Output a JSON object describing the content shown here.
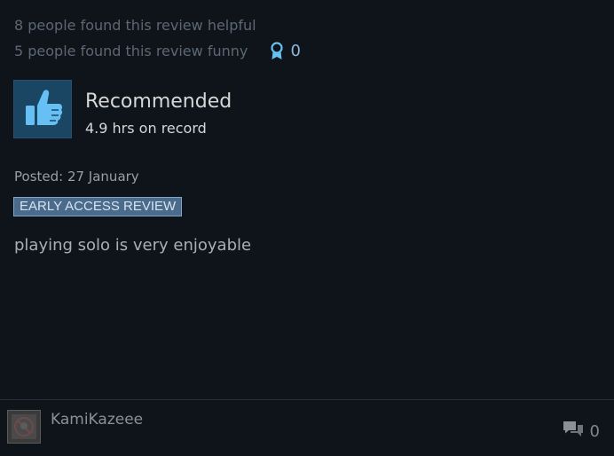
{
  "review": {
    "helpful_text": "8 people found this review helpful",
    "funny_text": "5 people found this review funny",
    "award_count": "0",
    "recommendation": "Recommended",
    "hours": "4.9 hrs on record",
    "posted": "Posted: 27 January",
    "badge": "EARLY ACCESS REVIEW",
    "body": "playing solo is very enjoyable"
  },
  "author": {
    "name": "KamiKazeee",
    "comment_count": "0"
  },
  "icons": {
    "thumb": "thumbs-up-icon",
    "award": "award-icon",
    "comment": "comment-icon"
  },
  "colors": {
    "background": "#0f141b",
    "accent": "#66c0f4",
    "badge_bg": "#4b6b8c"
  }
}
